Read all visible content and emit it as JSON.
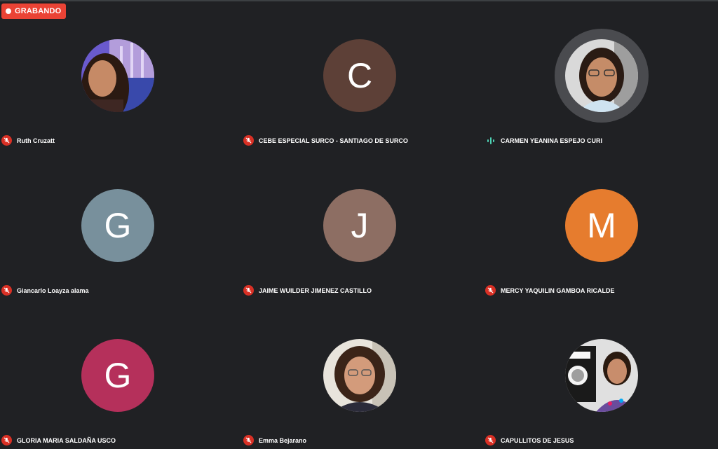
{
  "recording": {
    "label": "GRABANDO",
    "color": "#ea4335"
  },
  "participants": [
    {
      "name": "Ruth Cruzatt",
      "avatar_type": "photo",
      "mic": "muted"
    },
    {
      "name": "CEBE ESPECIAL SURCO - SANTIAGO DE SURCO",
      "avatar_type": "letter",
      "initial": "C",
      "color": "#5d4037",
      "mic": "muted"
    },
    {
      "name": "CARMEN YEANINA ESPEJO CURI",
      "avatar_type": "photo",
      "mic": "speaking",
      "active_speaker": true
    },
    {
      "name": "Giancarlo Loayza alama",
      "avatar_type": "letter",
      "initial": "G",
      "color": "#78909c",
      "mic": "muted"
    },
    {
      "name": "JAIME WUILDER JIMENEZ CASTILLO",
      "avatar_type": "letter",
      "initial": "J",
      "color": "#8d6e63",
      "mic": "muted"
    },
    {
      "name": "MERCY YAQUILIN GAMBOA RICALDE",
      "avatar_type": "letter",
      "initial": "M",
      "color": "#e67c2e",
      "mic": "muted"
    },
    {
      "name": "GLORIA MARIA SALDAÑA USCO",
      "avatar_type": "letter",
      "initial": "G",
      "color": "#b5305b",
      "mic": "muted"
    },
    {
      "name": "Emma Bejarano",
      "avatar_type": "photo",
      "mic": "muted"
    },
    {
      "name": "CAPULLITOS DE JESUS",
      "avatar_type": "photo",
      "mic": "muted"
    }
  ],
  "icons": {
    "muted": "mic-off-icon",
    "speaking": "audio-wave-icon"
  }
}
